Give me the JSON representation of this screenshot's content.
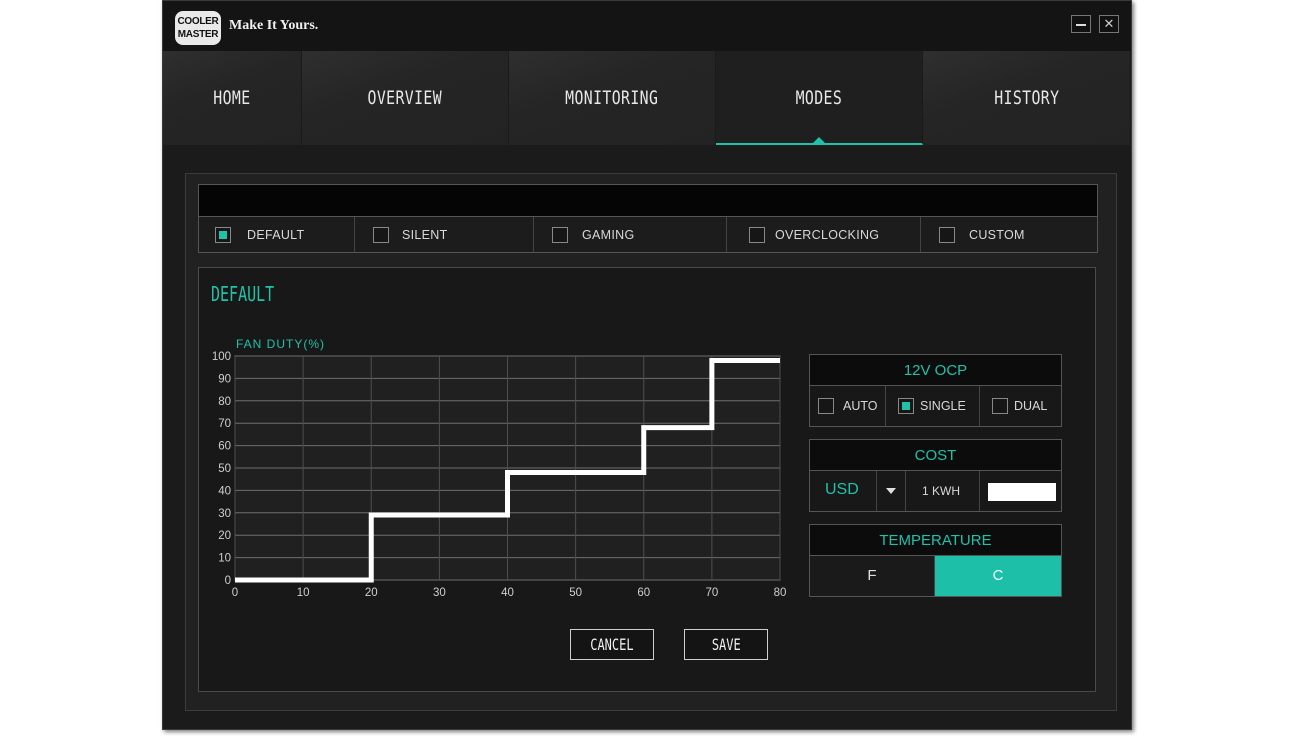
{
  "brand": {
    "logo_line1": "COOLER",
    "logo_line2": "MASTER",
    "slogan": "Make It Yours."
  },
  "window": {
    "minimize": "—",
    "close": "✕"
  },
  "nav": {
    "tabs": [
      {
        "label": "HOME"
      },
      {
        "label": "OVERVIEW"
      },
      {
        "label": "MONITORING"
      },
      {
        "label": "MODES"
      },
      {
        "label": "HISTORY"
      }
    ],
    "active": "MODES"
  },
  "modes": {
    "options": [
      {
        "label": "DEFAULT",
        "checked": true
      },
      {
        "label": "SILENT",
        "checked": false
      },
      {
        "label": "GAMING",
        "checked": false
      },
      {
        "label": "OVERCLOCKING",
        "checked": false
      },
      {
        "label": "CUSTOM",
        "checked": false
      }
    ]
  },
  "panel": {
    "title": "DEFAULT"
  },
  "chart_data": {
    "type": "line",
    "ylabel": "FAN DUTY(%)",
    "xlabel": "",
    "x_ticks": [
      0,
      10,
      20,
      30,
      40,
      50,
      60,
      70,
      80
    ],
    "y_ticks": [
      0,
      10,
      20,
      30,
      40,
      50,
      60,
      70,
      80,
      90,
      100
    ],
    "xlim": [
      0,
      80
    ],
    "ylim": [
      0,
      100
    ],
    "grid": true,
    "step_points": [
      [
        0,
        0
      ],
      [
        20,
        0
      ],
      [
        20,
        29
      ],
      [
        40,
        29
      ],
      [
        40,
        48
      ],
      [
        60,
        48
      ],
      [
        60,
        68
      ],
      [
        70,
        68
      ],
      [
        70,
        98
      ],
      [
        80,
        98
      ]
    ]
  },
  "ocp": {
    "title": "12V OCP",
    "options": [
      {
        "label": "AUTO",
        "checked": false
      },
      {
        "label": "SINGLE",
        "checked": true
      },
      {
        "label": "DUAL",
        "checked": false
      }
    ]
  },
  "cost": {
    "title": "COST",
    "currency": "USD",
    "unit": "1 KWH",
    "value": ""
  },
  "temperature": {
    "title": "TEMPERATURE",
    "f_label": "F",
    "c_label": "C",
    "selected": "C"
  },
  "actions": {
    "cancel": "CANCEL",
    "save": "SAVE"
  },
  "colors": {
    "accent": "#20c1aa",
    "background": "#1b1b1b"
  }
}
